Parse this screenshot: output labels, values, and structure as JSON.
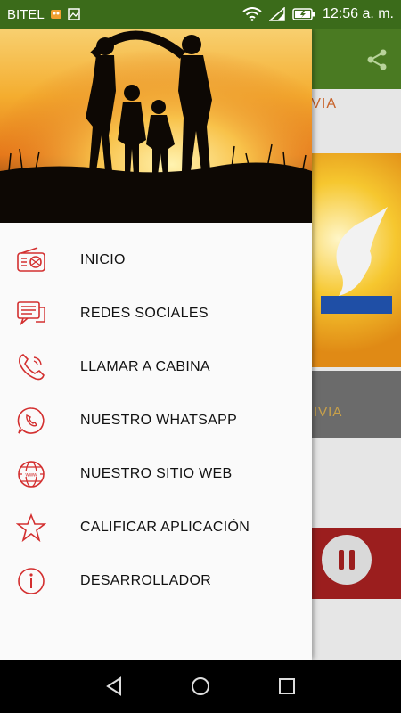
{
  "status_bar": {
    "carrier": "BITEL",
    "time": "12:56 a. m.",
    "icons": [
      "notification-icon",
      "image-icon",
      "wifi-icon",
      "signal-icon",
      "battery-charging-icon"
    ]
  },
  "app": {
    "title_partial": "IVIA",
    "band_text_partial": "IVIA",
    "share_icon": "share-icon",
    "pause_icon": "pause-icon"
  },
  "drawer": {
    "header_image": "family-silhouette-sunset",
    "items": [
      {
        "label": "INICIO",
        "icon": "radio-icon"
      },
      {
        "label": "REDES SOCIALES",
        "icon": "chat-icon"
      },
      {
        "label": "LLAMAR A CABINA",
        "icon": "phone-icon"
      },
      {
        "label": "NUESTRO WHATSAPP",
        "icon": "whatsapp-icon"
      },
      {
        "label": "NUESTRO SITIO WEB",
        "icon": "web-icon"
      },
      {
        "label": "CALIFICAR APLICACIÓN",
        "icon": "star-icon"
      },
      {
        "label": "DESARROLLADOR",
        "icon": "info-icon"
      }
    ]
  },
  "nav_bar": {
    "buttons": [
      "back-icon",
      "home-icon",
      "recents-icon"
    ]
  },
  "colors": {
    "accent": "#d32f2f",
    "toolbar": "#4a7a22",
    "status_bar": "#3b6b1a",
    "player": "#9b1e1e"
  }
}
